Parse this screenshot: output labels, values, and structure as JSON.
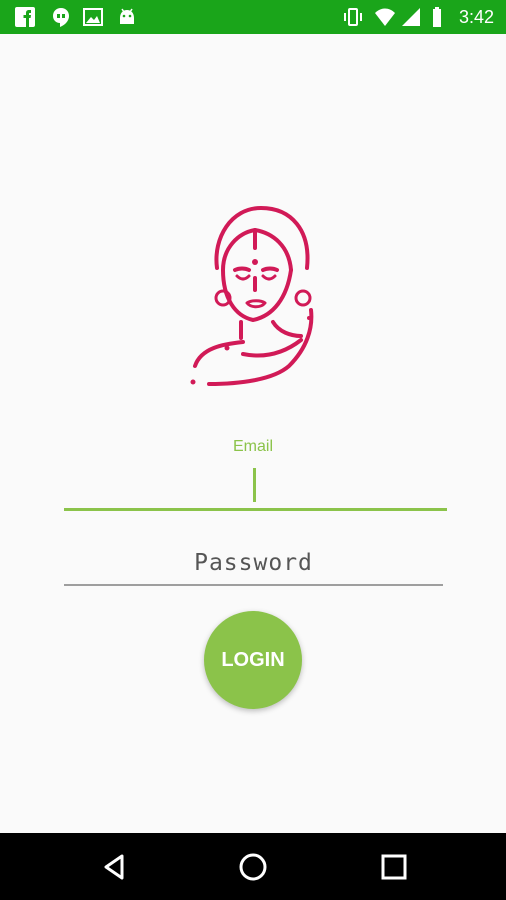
{
  "status_bar": {
    "time": "3:42",
    "left_icons": [
      "facebook-icon",
      "hangouts-icon",
      "image-icon",
      "android-icon"
    ],
    "right_icons": [
      "vibrate-icon",
      "wifi-icon",
      "signal-icon",
      "battery-icon"
    ],
    "background": "#1aa51a"
  },
  "login": {
    "email_label": "Email",
    "email_value": "",
    "password_placeholder": "Password",
    "button_label": "LOGIN"
  },
  "nav_bar": {
    "buttons": [
      "back-icon",
      "home-icon",
      "recents-icon"
    ]
  },
  "colors": {
    "accent": "#8bc34a",
    "logo": "#d11a57",
    "status_bar": "#1aa51a"
  }
}
